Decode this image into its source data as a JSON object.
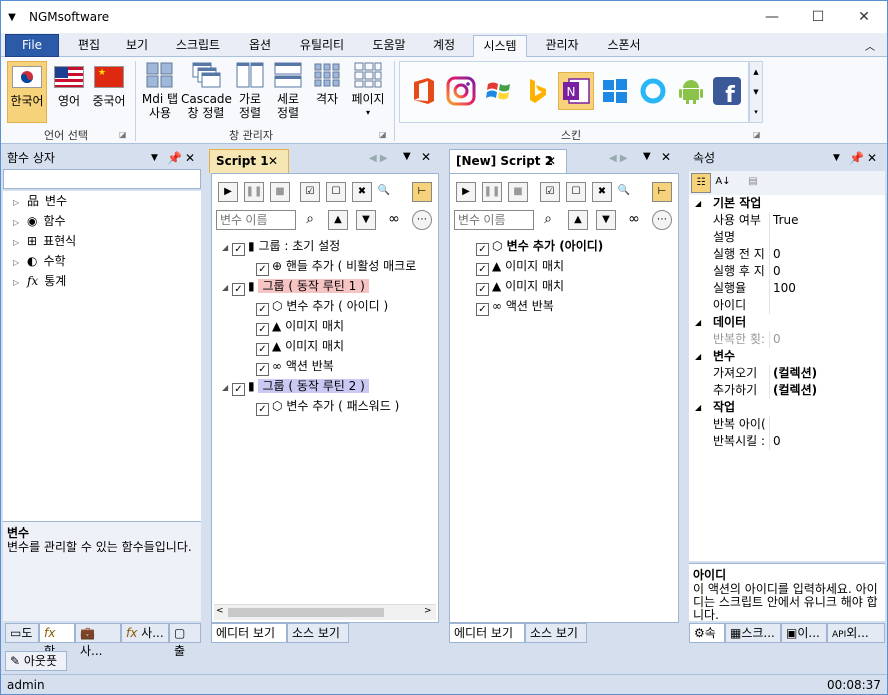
{
  "window": {
    "title": "NGMsoftware",
    "minimize": "—",
    "maximize": "☐",
    "close": "✕"
  },
  "menu": {
    "file": "File",
    "tabs": [
      "편집",
      "보기",
      "스크립트",
      "옵션",
      "유틸리티",
      "도움말",
      "계정",
      "시스템",
      "관리자",
      "스폰서"
    ],
    "active": "시스템"
  },
  "ribbon": {
    "lang_group": {
      "label": "언어 선택",
      "items": [
        "한국어",
        "영어",
        "중국어"
      ]
    },
    "window_group": {
      "label": "창 관리자",
      "items": [
        [
          "Mdi 탭",
          "사용"
        ],
        [
          "Cascade",
          "창 정렬"
        ],
        [
          "가로",
          "정렬"
        ],
        [
          "세로",
          "정렬"
        ],
        [
          "격자",
          ""
        ],
        [
          "페이지",
          "▾"
        ]
      ]
    },
    "skin_group": {
      "label": "스킨"
    }
  },
  "func_panel": {
    "title": "함수 상자",
    "items": [
      "변수",
      "함수",
      "표현식",
      "수학",
      "통계"
    ],
    "desc_title": "변수",
    "desc_text": "변수를 관리할 수 있는 함수들입니다.",
    "bottom_tabs": [
      "도",
      "함",
      "사...",
      "사...",
      "출"
    ],
    "outline": "아웃풋"
  },
  "script1": {
    "tab": "Script 1",
    "search_placeholder": "변수 이름",
    "rows": [
      {
        "level": 0,
        "text": "그룹 : 초기 설정",
        "hl": ""
      },
      {
        "level": 1,
        "text": "핸들 추가 ( 비활성 매크로",
        "hl": ""
      },
      {
        "level": 0,
        "text": "그룹 ( 동작 루틴 1 )",
        "hl": "red"
      },
      {
        "level": 1,
        "text": "변수 추가 ( 아이디 )",
        "hl": ""
      },
      {
        "level": 1,
        "text": "이미지 매치",
        "hl": ""
      },
      {
        "level": 1,
        "text": "이미지 매치",
        "hl": ""
      },
      {
        "level": 1,
        "text": "액션 반복",
        "hl": ""
      },
      {
        "level": 0,
        "text": "그룹 ( 동작 루틴 2 )",
        "hl": "blue"
      },
      {
        "level": 1,
        "text": "변수 추가 ( 패스워드 )",
        "hl": ""
      }
    ],
    "bottom_tabs": [
      "에디터 보기",
      "소스 보기"
    ]
  },
  "script2": {
    "tab": "[New] Script 2",
    "search_placeholder": "변수 이름",
    "rows": [
      {
        "text": "변수 추가 (아이디)",
        "bold": true
      },
      {
        "text": "이미지 매치",
        "bold": false
      },
      {
        "text": "이미지 매치",
        "bold": false
      },
      {
        "text": "액션 반복",
        "bold": false
      }
    ],
    "bottom_tabs": [
      "에디터 보기",
      "소스 보기"
    ]
  },
  "props": {
    "title": "속성",
    "rows": [
      {
        "cat": true,
        "k": "기본 작업",
        "v": ""
      },
      {
        "cat": false,
        "k": "사용 여부",
        "v": "True"
      },
      {
        "cat": false,
        "k": "설명",
        "v": ""
      },
      {
        "cat": false,
        "k": "실행 전 지",
        "v": "0"
      },
      {
        "cat": false,
        "k": "실행 후 지",
        "v": "0"
      },
      {
        "cat": false,
        "k": "실행율",
        "v": "100"
      },
      {
        "cat": false,
        "k": "아이디",
        "v": ""
      },
      {
        "cat": true,
        "k": "데이터",
        "v": ""
      },
      {
        "cat": false,
        "k": "반복한 횟:",
        "v": "0",
        "gray": true
      },
      {
        "cat": true,
        "k": "변수",
        "v": ""
      },
      {
        "cat": false,
        "k": "가져오기",
        "v": "(컬렉션)",
        "boldv": true
      },
      {
        "cat": false,
        "k": "추가하기",
        "v": "(컬렉션)",
        "boldv": true
      },
      {
        "cat": true,
        "k": "작업",
        "v": ""
      },
      {
        "cat": false,
        "k": "반복 아이(",
        "v": ""
      },
      {
        "cat": false,
        "k": "반복시킬 :",
        "v": "0"
      }
    ],
    "desc_title": "아이디",
    "desc_text": "이 액션의 아이디를 입력하세요. 아이디는 스크립트 안에서 유니크 해야 합니다.",
    "bottom_tabs": [
      "속",
      "스크...",
      "이...",
      "외..."
    ]
  },
  "status": {
    "user": "admin",
    "time": "00:08:37"
  },
  "colors": {
    "file_tab": "#2b5aa8",
    "accent_yellow": "#f6d27a",
    "highlight_red": "#f7c4c4",
    "highlight_blue": "#c9c9f3"
  }
}
